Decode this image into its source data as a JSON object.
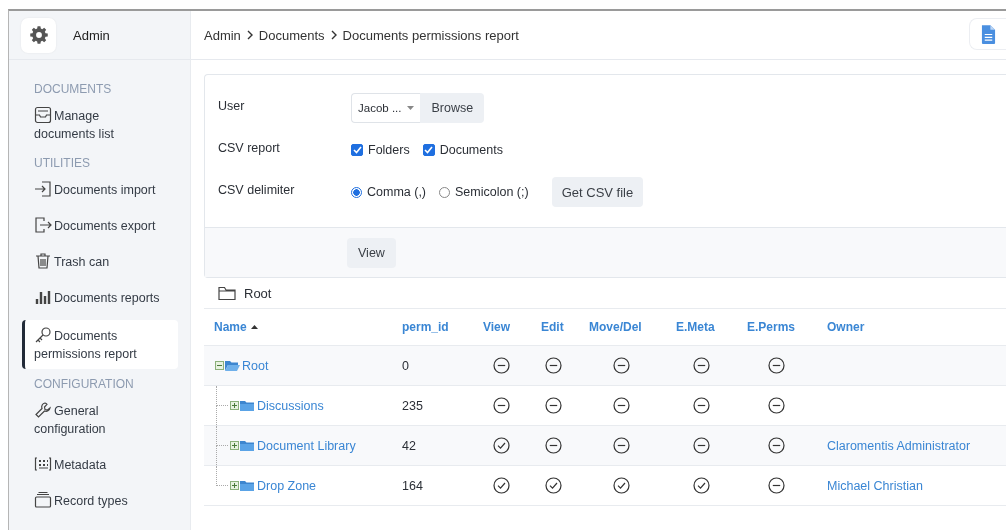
{
  "header": {
    "app_title": "Admin",
    "breadcrumb": [
      "Admin",
      "Documents",
      "Documents permissions report"
    ]
  },
  "sidebar": {
    "sections": [
      {
        "title": "DOCUMENTS",
        "items": [
          {
            "label": "Manage documents list",
            "selected": false
          }
        ]
      },
      {
        "title": "UTILITIES",
        "items": [
          {
            "label": "Documents import",
            "selected": false
          },
          {
            "label": "Documents export",
            "selected": false
          },
          {
            "label": "Trash can",
            "selected": false
          },
          {
            "label": "Documents reports",
            "selected": false
          },
          {
            "label": "Documents permissions report",
            "selected": true
          }
        ]
      },
      {
        "title": "CONFIGURATION",
        "items": [
          {
            "label": "General configuration",
            "selected": false
          },
          {
            "label": "Metadata",
            "selected": false
          },
          {
            "label": "Record types",
            "selected": false
          }
        ]
      }
    ]
  },
  "form": {
    "fields": [
      {
        "label": "User",
        "kind": "user-picker",
        "value": "Jacob ...",
        "button": "Browse"
      },
      {
        "label": "CSV report",
        "kind": "checkboxes",
        "options": [
          {
            "label": "Folders",
            "checked": true
          },
          {
            "label": "Documents",
            "checked": true
          }
        ]
      },
      {
        "label": "CSV delimiter",
        "kind": "radios",
        "options": [
          {
            "label": "Comma (,)",
            "selected": true
          },
          {
            "label": "Semicolon (;)",
            "selected": false
          }
        ],
        "button": "Get CSV file"
      }
    ],
    "submit": "View"
  },
  "folder_path": "Root",
  "table": {
    "columns": [
      {
        "label": "Name",
        "sorted_ascending": true
      },
      {
        "label": "perm_id"
      },
      {
        "label": "View"
      },
      {
        "label": "Edit"
      },
      {
        "label": "Move/Del"
      },
      {
        "label": "E.Meta"
      },
      {
        "label": "E.Perms"
      },
      {
        "label": "Owner"
      }
    ],
    "rows": [
      {
        "name": "Root",
        "perm_id": "0",
        "expanded": true,
        "perms": [
          {
            "granted": false
          },
          {
            "granted": false
          },
          {
            "granted": false
          },
          {
            "granted": false
          },
          {
            "granted": false
          }
        ],
        "children": [
          {
            "name": "Discussions",
            "perm_id": "235",
            "expanded": false,
            "perms": [
              {
                "granted": false
              },
              {
                "granted": false
              },
              {
                "granted": false
              },
              {
                "granted": false
              },
              {
                "granted": false
              }
            ]
          },
          {
            "name": "Document Library",
            "perm_id": "42",
            "expanded": false,
            "perms": [
              {
                "granted": true
              },
              {
                "granted": false
              },
              {
                "granted": false
              },
              {
                "granted": false
              },
              {
                "granted": false
              }
            ],
            "owner": "Claromentis Administrator"
          },
          {
            "name": "Drop Zone",
            "perm_id": "164",
            "expanded": false,
            "perms": [
              {
                "granted": true
              },
              {
                "granted": true
              },
              {
                "granted": true
              },
              {
                "granted": true
              },
              {
                "granted": false
              }
            ],
            "owner": "Michael Christian"
          }
        ]
      }
    ]
  }
}
